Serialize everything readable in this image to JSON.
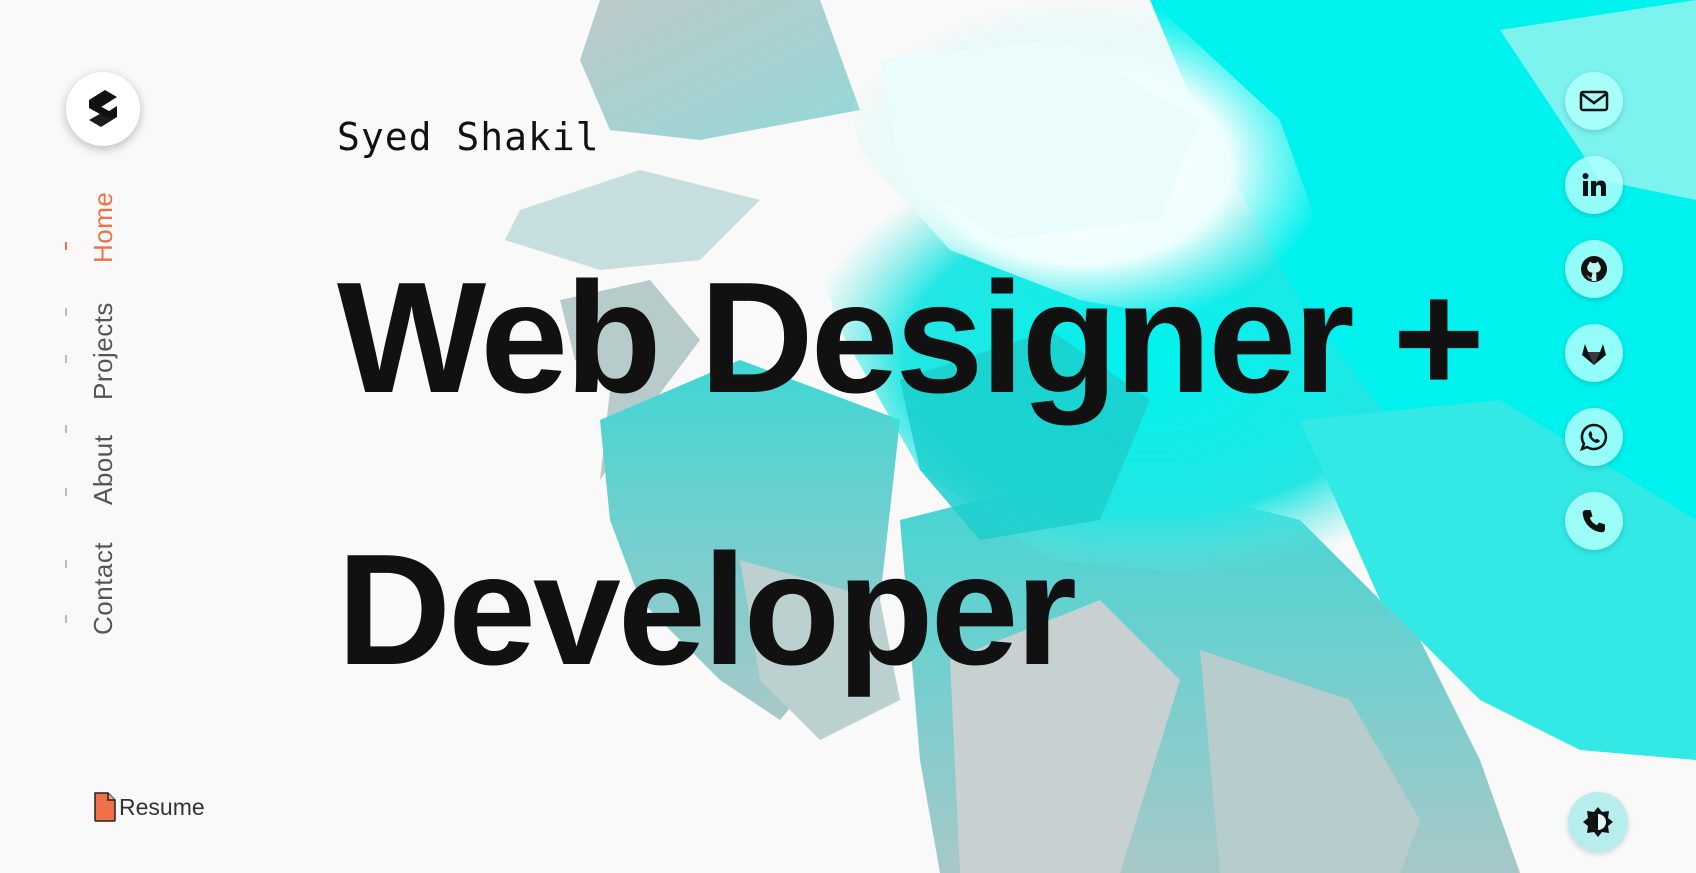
{
  "brand": {
    "logo_icon": "s-logo-icon"
  },
  "nav": {
    "items": [
      {
        "label": "Home",
        "active": true
      },
      {
        "label": "Projects",
        "active": false
      },
      {
        "label": "About",
        "active": false
      },
      {
        "label": "Contact",
        "active": false
      }
    ],
    "active_color": "#f07148"
  },
  "hero": {
    "name": "Syed Shakil",
    "line1": "Web Designer +",
    "line2": "Developer"
  },
  "resume": {
    "label": "Resume",
    "icon": "document-icon",
    "icon_color": "#f07148"
  },
  "social": [
    {
      "name": "email",
      "icon": "mail-icon"
    },
    {
      "name": "linkedin",
      "icon": "linkedin-icon"
    },
    {
      "name": "github",
      "icon": "github-icon"
    },
    {
      "name": "gitlab",
      "icon": "gitlab-icon"
    },
    {
      "name": "whatsapp",
      "icon": "whatsapp-icon"
    },
    {
      "name": "phone",
      "icon": "phone-icon"
    }
  ],
  "theme_toggle": {
    "icon": "contrast-icon"
  },
  "colors": {
    "accent": "#f07148",
    "art_cyan": "#12f0ee",
    "text": "#111111"
  }
}
